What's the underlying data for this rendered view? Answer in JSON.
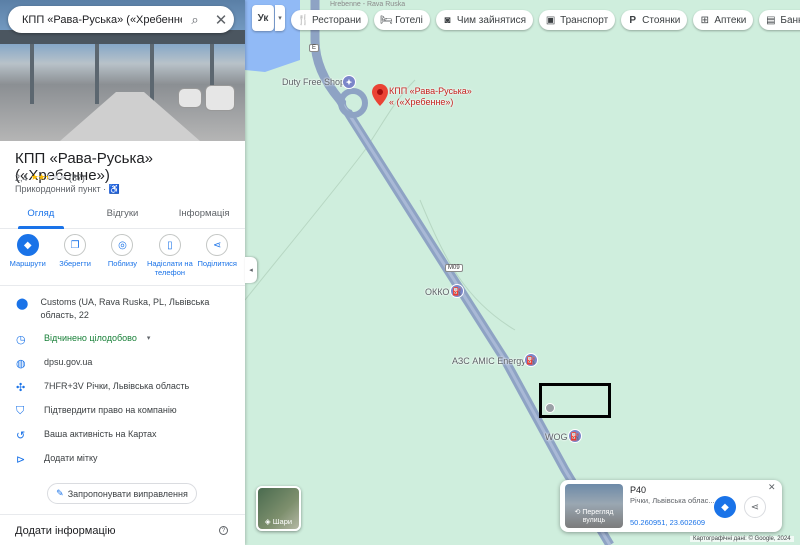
{
  "search": {
    "query": "КПП «Рава-Руська» («Хребенне»)"
  },
  "place": {
    "title": "КПП «Рава-Руська» («Хребенне»)",
    "rating": "2,4",
    "stars": 2.4,
    "review_count": "(87)",
    "category": "Прикордонний пункт"
  },
  "tabs": [
    "Огляд",
    "Відгуки",
    "Інформація"
  ],
  "actions": [
    {
      "label": "Маршрути",
      "icon": "directions-icon"
    },
    {
      "label": "Зберегти",
      "icon": "bookmark-icon"
    },
    {
      "label": "Поблизу",
      "icon": "nearby-icon"
    },
    {
      "label": "Надіслати на телефон",
      "icon": "phone-icon"
    },
    {
      "label": "Поділитися",
      "icon": "share-icon"
    }
  ],
  "info": {
    "address": "Customs (UA, Rava Ruska, PL, Львівська область, 22",
    "hours": "Відчинено цілодобово",
    "website": "dpsu.gov.ua",
    "plus_code": "7HFR+3V Річки, Львівська область",
    "claim": "Підтвердити право на компанію",
    "activity": "Ваша активність на Картах",
    "label": "Додати мітку"
  },
  "suggest_edit": "Запропонувати виправлення",
  "add_info": "Додати інформацію",
  "map": {
    "lang_chip": "Ук",
    "chips": [
      {
        "label": "Ресторани",
        "icon": "restaurant-icon"
      },
      {
        "label": "Готелі",
        "icon": "hotel-icon"
      },
      {
        "label": "Чим зайнятися",
        "icon": "camera-icon"
      },
      {
        "label": "Транспорт",
        "icon": "transit-icon"
      },
      {
        "label": "Стоянки",
        "icon": "parking-icon"
      },
      {
        "label": "Аптеки",
        "icon": "pharmacy-icon"
      },
      {
        "label": "Банкомати",
        "icon": "atm-icon"
      }
    ],
    "pin_label_line1": "КПП «Рава-Руська»",
    "pin_label_line2": "« («Хребенне»)",
    "poi_duty_free": "Duty Free Shop",
    "poi_okko": "ОККО",
    "poi_amic": "АЗС AMIC Energy",
    "poi_wog": "WOG",
    "road_m09": "М09",
    "top_faded_1": "Hrebenne - Rava Ruska",
    "layers_label": "Шари"
  },
  "streetview_card": {
    "thumb_label": "Перегляд вулиць",
    "name": "Р40",
    "address": "Річки, Львівська облас...",
    "coords": "50.260951, 23.602609"
  },
  "footer": "Картографічні дані: © Google, 2024"
}
